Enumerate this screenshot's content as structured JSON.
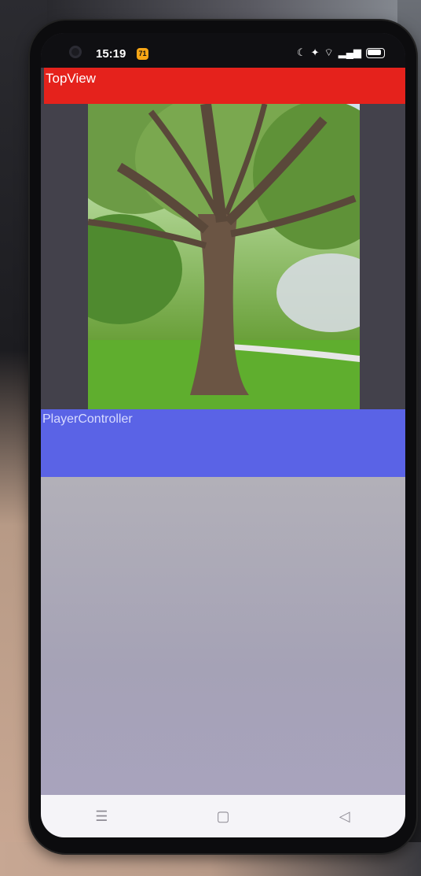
{
  "status_bar": {
    "time": "15:19",
    "notification_badge": "71",
    "icons": [
      "moon-icon",
      "nfc-icon",
      "wifi-icon",
      "signal-icon",
      "battery-icon"
    ]
  },
  "top_view": {
    "label": "TopView",
    "color": "#e5221c"
  },
  "player_controller": {
    "label": "PlayerController",
    "color": "#5a63e6"
  },
  "navigation_bar": {
    "icons": [
      "menu-icon",
      "home-square-icon",
      "back-triangle-icon"
    ]
  }
}
